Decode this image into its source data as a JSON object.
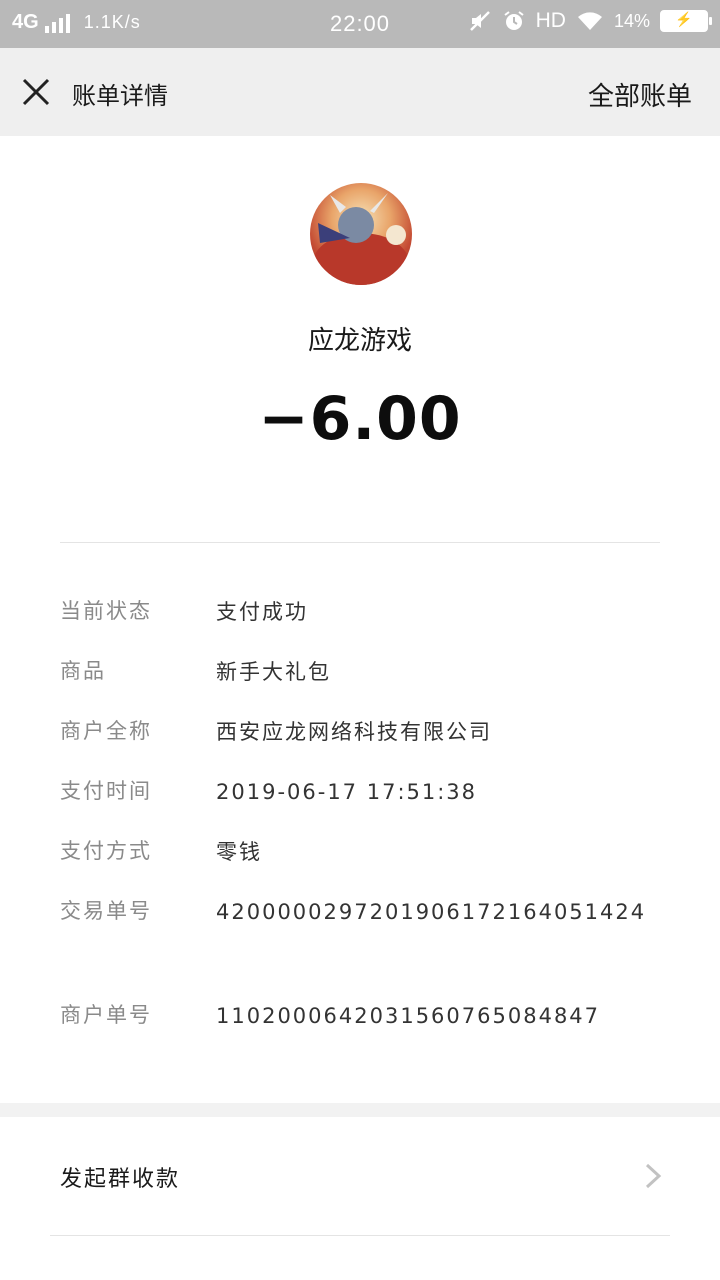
{
  "status_bar": {
    "network": "4G",
    "speed": "1.1K/s",
    "time": "22:00",
    "hd": "HD",
    "battery": "14%"
  },
  "header": {
    "title": "账单详情",
    "right_link": "全部账单"
  },
  "merchant": {
    "name": "应龙游戏",
    "amount": "−6.00"
  },
  "details": [
    {
      "label": "当前状态",
      "value": "支付成功"
    },
    {
      "label": "商品",
      "value": "新手大礼包"
    },
    {
      "label": "商户全称",
      "value": "西安应龙网络科技有限公司"
    },
    {
      "label": "支付时间",
      "value": "2019-06-17 17:51:38"
    },
    {
      "label": "支付方式",
      "value": "零钱"
    },
    {
      "label": "交易单号",
      "value": "4200000297201906172164051424"
    },
    {
      "label": "商户单号",
      "value": "1102000642031560765084847"
    }
  ],
  "actions": {
    "group_collect": "发起群收款"
  },
  "colors": {
    "status_bar_bg": "#b9b9b9",
    "header_bg": "#efefef",
    "label_gray": "#8a8a8a"
  }
}
